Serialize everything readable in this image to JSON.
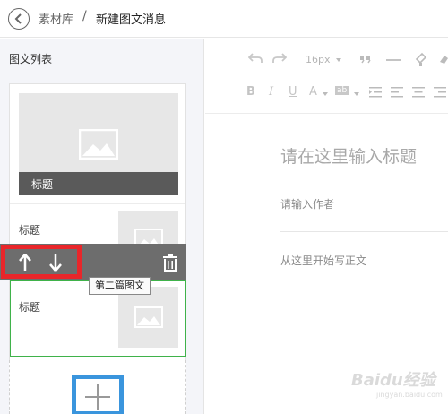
{
  "header": {
    "breadcrumb_parent": "素材库",
    "separator": "/",
    "breadcrumb_current": "新建图文消息"
  },
  "sidebar": {
    "title": "图文列表",
    "cover_caption": "标题",
    "items": [
      {
        "title": "标题"
      },
      {
        "title": "标题"
      }
    ],
    "tooltip": "第二篇图文"
  },
  "toolbar": {
    "font_size": "16px",
    "bold": "B",
    "italic": "I",
    "underline": "U",
    "font_color": "A",
    "bg_color": "ab"
  },
  "editor": {
    "title_placeholder": "请在这里输入标题",
    "author_placeholder": "请输入作者",
    "body_placeholder": "从这里开始写正文"
  },
  "watermark": {
    "text": "Baidu经验",
    "sub": "jingyan.baidu.com"
  },
  "colors": {
    "highlight_red": "#e8262a",
    "selected_green": "#3fb24a",
    "add_blue": "#3a95dd"
  }
}
